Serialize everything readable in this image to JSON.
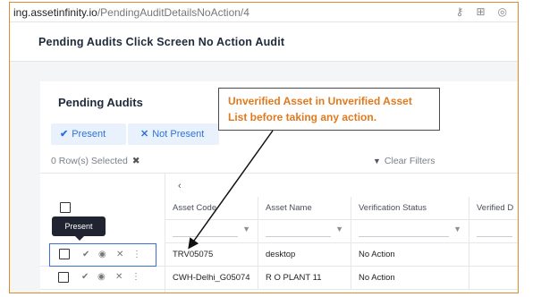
{
  "browser": {
    "url_host": "ing.assetinfinity.io",
    "url_path": "/PendingAuditDetailsNoAction/4",
    "icons": [
      "key-icon",
      "grid-icon"
    ]
  },
  "page": {
    "title": "Pending Audits Click Screen No Action Audit"
  },
  "card": {
    "title": "Pending Audits",
    "present_label": "Present",
    "not_present_label": "Not Present",
    "selected_text": "0 Row(s) Selected",
    "clear_filters_label": "Clear Filters"
  },
  "table": {
    "scroll_left_icon": "‹",
    "columns": [
      "Asset Code",
      "Asset Name",
      "Verification Status",
      "Verified D"
    ],
    "rows": [
      {
        "code": "TRV05075",
        "name": "desktop",
        "status": "No Action"
      },
      {
        "code": "CWH-Delhi_G05074",
        "name": "R O PLANT 11",
        "status": "No Action"
      }
    ]
  },
  "tooltip": {
    "text": "Present"
  },
  "callout": {
    "text": "Unverified Asset in Unverified Asset List before taking any action."
  },
  "colors": {
    "frame": "#e08a2e",
    "accent_blue": "#2f73d9",
    "callout_text": "#e07a1f",
    "highlight": "#3a6fd8"
  }
}
